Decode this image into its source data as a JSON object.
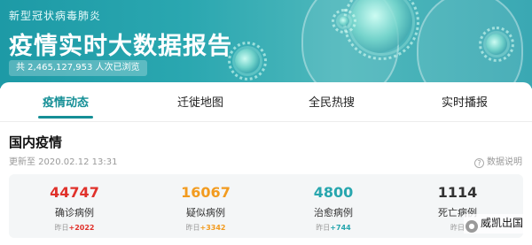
{
  "header": {
    "subtitle": "新型冠状病毒肺炎",
    "title": "疫情实时大数据报告",
    "views": "共 2,465,127,953 人次已浏览"
  },
  "tabs": [
    {
      "label": "疫情动态",
      "active": true
    },
    {
      "label": "迁徙地图",
      "active": false
    },
    {
      "label": "全民热搜",
      "active": false
    },
    {
      "label": "实时播报",
      "active": false
    }
  ],
  "domestic": {
    "title": "国内疫情",
    "updated": "更新至 2020.02.12 13:31",
    "help": "数据说明",
    "stats": [
      {
        "value": "44747",
        "label": "确诊病例",
        "delta_prefix": "昨日",
        "delta": "+2022",
        "color": "#e0312b",
        "delta_color": "#e0312b"
      },
      {
        "value": "16067",
        "label": "疑似病例",
        "delta_prefix": "昨日",
        "delta": "+3342",
        "color": "#f29b1f",
        "delta_color": "#f29b1f"
      },
      {
        "value": "4800",
        "label": "治愈病例",
        "delta_prefix": "昨日",
        "delta": "+744",
        "color": "#27a6ae",
        "delta_color": "#27a6ae"
      },
      {
        "value": "1114",
        "label": "死亡病例",
        "delta_prefix": "昨日",
        "delta": "",
        "color": "#333333",
        "delta_color": "#333333"
      }
    ]
  },
  "watermark": {
    "text": "威凯出国"
  },
  "colors": {
    "accent": "#158f96",
    "banner": "#2aa7b0"
  }
}
